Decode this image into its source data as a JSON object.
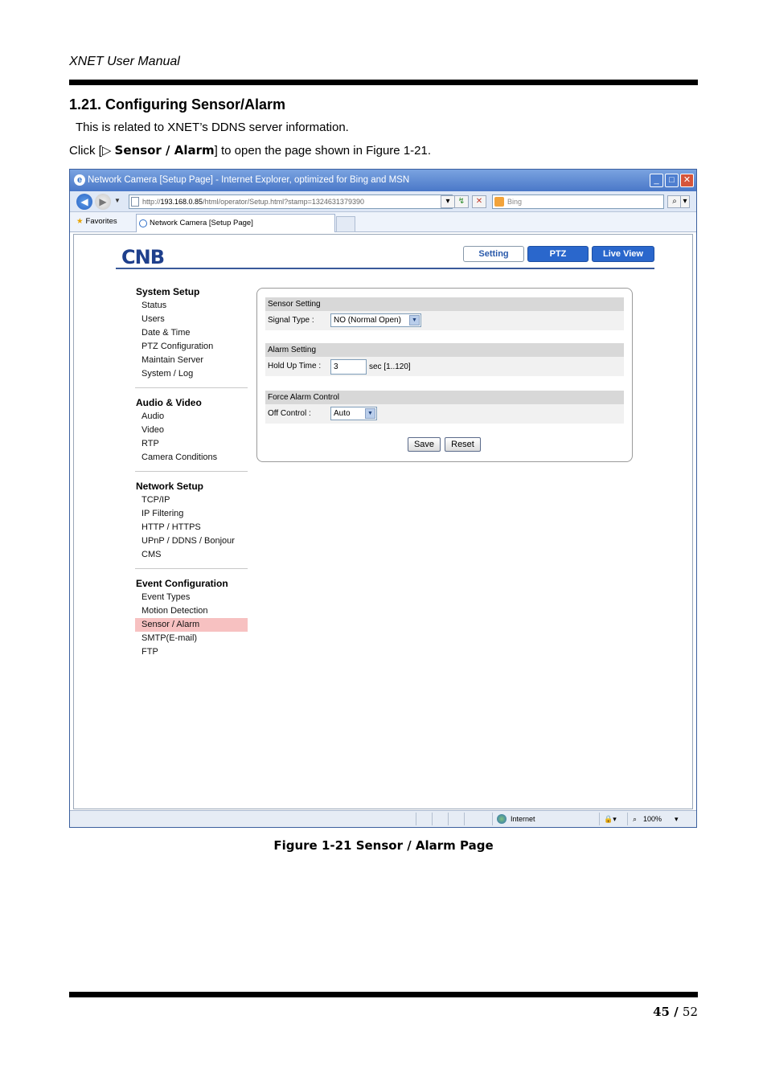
{
  "header": {
    "manual_title": "XNET User Manual"
  },
  "section": {
    "heading": "1.21. Configuring Sensor/Alarm",
    "intro": "This is related to XNET’s DDNS server information.",
    "click_prefix": "Click [▷ ",
    "click_bold": "Sensor / Alarm",
    "click_suffix": "] to open the page shown in Figure 1-21."
  },
  "browser": {
    "window_title": "Network Camera [Setup Page] - Internet Explorer, optimized for Bing and MSN",
    "url_prefix": "http://",
    "url_host": "193.168.0.85",
    "url_path": "/html/operator/Setup.html?stamp=1324631379390",
    "search_placeholder": "Bing",
    "favorites_label": "Favorites",
    "tab_label": "Network Camera [Setup Page]",
    "status_zone": "Internet",
    "zoom": "100%"
  },
  "app": {
    "logo": "CNB",
    "top_tabs": {
      "setting": "Setting",
      "ptz": "PTZ",
      "live_view": "Live View"
    },
    "sidebar": {
      "system_setup": {
        "title": "System Setup",
        "items": [
          "Status",
          "Users",
          "Date & Time",
          "PTZ Configuration",
          "Maintain Server",
          "System / Log"
        ]
      },
      "audio_video": {
        "title": "Audio & Video",
        "items": [
          "Audio",
          "Video",
          "RTP",
          "Camera Conditions"
        ]
      },
      "network_setup": {
        "title": "Network Setup",
        "items": [
          "TCP/IP",
          "IP Filtering",
          "HTTP / HTTPS",
          "UPnP / DDNS / Bonjour",
          "CMS"
        ]
      },
      "event_configuration": {
        "title": "Event Configuration",
        "items": [
          "Event Types",
          "Motion Detection",
          "Sensor / Alarm",
          "SMTP(E-mail)",
          "FTP"
        ],
        "active": "Sensor / Alarm"
      }
    },
    "form": {
      "sensor_setting": {
        "header": "Sensor Setting",
        "signal_type_label": "Signal Type :",
        "signal_type_value": "NO (Normal Open)"
      },
      "alarm_setting": {
        "header": "Alarm Setting",
        "hold_up_label": "Hold Up Time :",
        "hold_up_value": "3",
        "hold_up_hint": "sec [1..120]"
      },
      "force_alarm": {
        "header": "Force Alarm Control",
        "off_control_label": "Off Control :",
        "off_control_value": "Auto"
      },
      "save_label": "Save",
      "reset_label": "Reset"
    }
  },
  "figure_caption": "Figure 1-21 Sensor / Alarm Page",
  "footer": {
    "page_current": "45",
    "page_sep": " / ",
    "page_total": "52"
  },
  "colors": {
    "accent_blue": "#2a67cc",
    "active_item": "#f7c1c1"
  }
}
